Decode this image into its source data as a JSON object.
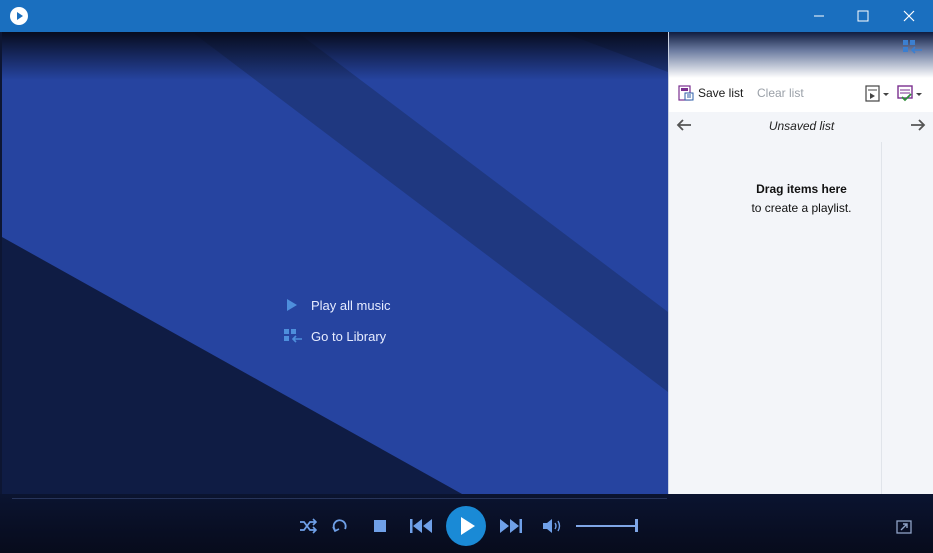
{
  "window": {
    "app_icon": "media-player-icon",
    "controls": [
      "minimize-icon",
      "maximize-icon",
      "close-icon"
    ]
  },
  "center": {
    "play_all_label": "Play all music",
    "library_label": "Go to Library"
  },
  "playlist": {
    "save_label": "Save list",
    "clear_label": "Clear list",
    "title": "Unsaved list",
    "empty_heading": "Drag items here",
    "empty_subtext": "to create a playlist."
  },
  "controls": {
    "icons": [
      "shuffle-icon",
      "repeat-icon",
      "stop-icon",
      "previous-icon",
      "play-icon",
      "next-icon",
      "volume-icon",
      "switch-to-now-playing-icon"
    ],
    "volume_fraction": 1.0
  },
  "colors": {
    "titlebar": "#1a6fbf",
    "accent": "#1a8ad6",
    "stage_blue": "#243f9a"
  }
}
